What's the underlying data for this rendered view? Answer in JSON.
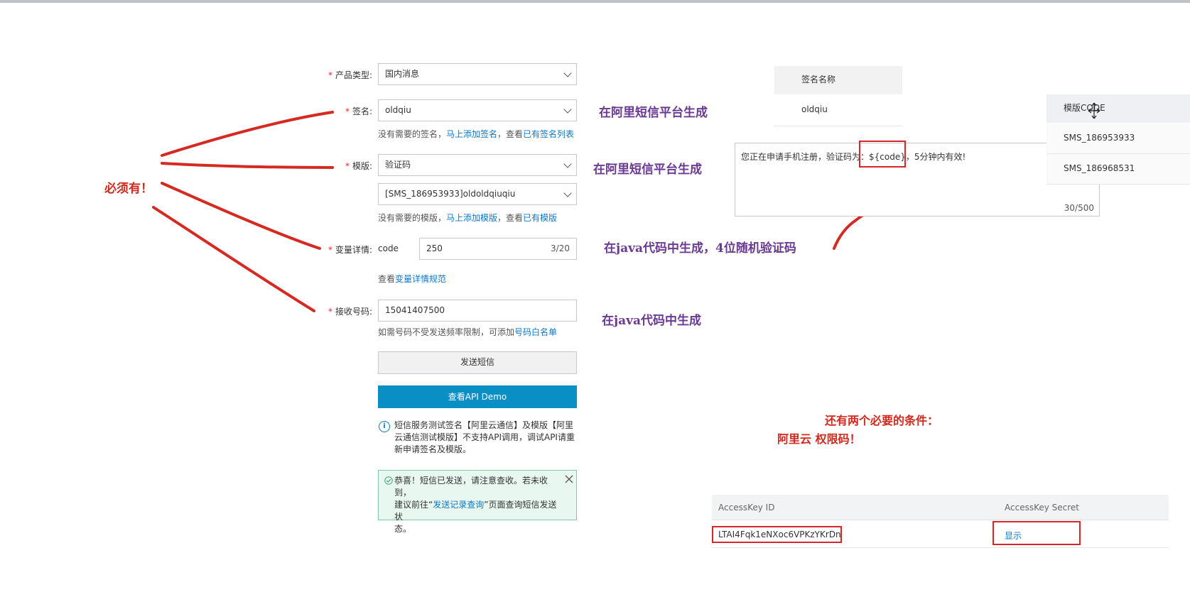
{
  "form": {
    "product_type": {
      "label": "产品类型:",
      "value": "国内消息"
    },
    "signature": {
      "label": "签名:",
      "value": "oldqiu",
      "hint_prefix": "没有需要的签名，",
      "hint_link1": "马上添加签名",
      "hint_mid": "，查看",
      "hint_link2": "已有签名列表"
    },
    "template": {
      "label": "模版:",
      "value": "验证码",
      "value2": "[SMS_186953933]oldoldqiuqiu",
      "hint_prefix": "没有需要的模版，",
      "hint_link1": "马上添加模版",
      "hint_mid": "，查看",
      "hint_link2": "已有模版"
    },
    "variables": {
      "label": "变量详情:",
      "name": "code",
      "value": "250",
      "counter": "3/20",
      "hint_prefix": "查看",
      "hint_link": "变量详情规范"
    },
    "phone": {
      "label": "接收号码:",
      "value": "15041407500",
      "hint_prefix": "如需号码不受发送频率限制，可添加",
      "hint_link": "号码白名单"
    },
    "send_button": "发送短信",
    "api_demo_button": "查看API Demo",
    "info_icon": "i",
    "notice_lines": [
      "短信服务测试签名【阿里云通信】及模版【阿里",
      "云通信测试模版】不支持API调用，调试API请重",
      "新申请签名及模版。"
    ],
    "success": {
      "line1": "恭喜！短信已发送，请注意查收。若未收到，",
      "line2_prefix": "建议前往“",
      "line2_link": "发送记录查询",
      "line2_suffix": "”页面查询短信发送状",
      "line3": "态。"
    }
  },
  "annotations": {
    "required": "必须有！",
    "sig_origin": "在阿里短信平台生成",
    "tmpl_origin": "在阿里短信平台生成",
    "code_origin": "在java代码中生成，4位随机验证码",
    "phone_origin": "在java代码中生成",
    "conditions_line1": "还有两个必要的条件：",
    "conditions_line2": "阿里云 权限码！"
  },
  "signature_table": {
    "header": "签名名称",
    "row": "oldqiu"
  },
  "template_preview": {
    "text_before": "您正在申请手机注册，验证码为：",
    "code": "${code}",
    "text_after": "，5分钟内有效!",
    "counter": "30/500"
  },
  "template_code_table": {
    "header": "模版CODE",
    "rows": [
      "SMS_186953933",
      "SMS_186968531"
    ]
  },
  "accesskey": {
    "id_header": "AccessKey ID",
    "secret_header": "AccessKey Secret",
    "id_value": "LTAI4Fqk1eNXoc6VPKzYKrDn",
    "secret_action": "显示"
  },
  "colors": {
    "annotation_purple": "#6b3a93",
    "annotation_red": "#d2291e",
    "link_blue": "#0b78c9",
    "primary_button": "#0a8fc5"
  }
}
